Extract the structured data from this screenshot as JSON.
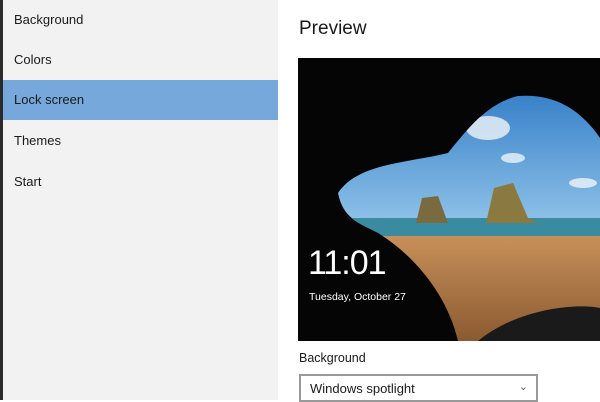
{
  "sidebar": {
    "items": [
      {
        "label": "Background"
      },
      {
        "label": "Colors"
      },
      {
        "label": "Lock screen",
        "selected": true
      },
      {
        "label": "Themes"
      },
      {
        "label": "Start"
      }
    ]
  },
  "main": {
    "title": "Preview",
    "preview": {
      "time": "11:01",
      "date": "Tuesday, October 27"
    },
    "background_label": "Background",
    "background_value": "Windows spotlight",
    "dropdown_icon": "chevron-down-icon"
  },
  "colors": {
    "accent": "#76a8dc",
    "sidebar": "#f2f2f2"
  }
}
